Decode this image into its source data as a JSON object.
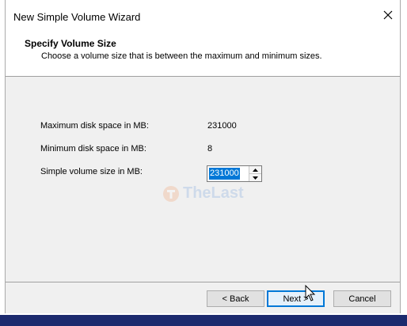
{
  "window": {
    "title": "New Simple Volume Wizard"
  },
  "header": {
    "title": "Specify Volume Size",
    "subtitle": "Choose a volume size that is between the maximum and minimum sizes."
  },
  "fields": {
    "max_label": "Maximum disk space in MB:",
    "max_value": "231000",
    "min_label": "Minimum disk space in MB:",
    "min_value": "8",
    "size_label": "Simple volume size in MB:",
    "size_value": "231000"
  },
  "buttons": {
    "back": "< Back",
    "next": "Next >",
    "cancel": "Cancel"
  },
  "watermark": {
    "text": "TheLast"
  },
  "colors": {
    "accent": "#0078d7",
    "taskbar": "#1c2a6e"
  }
}
